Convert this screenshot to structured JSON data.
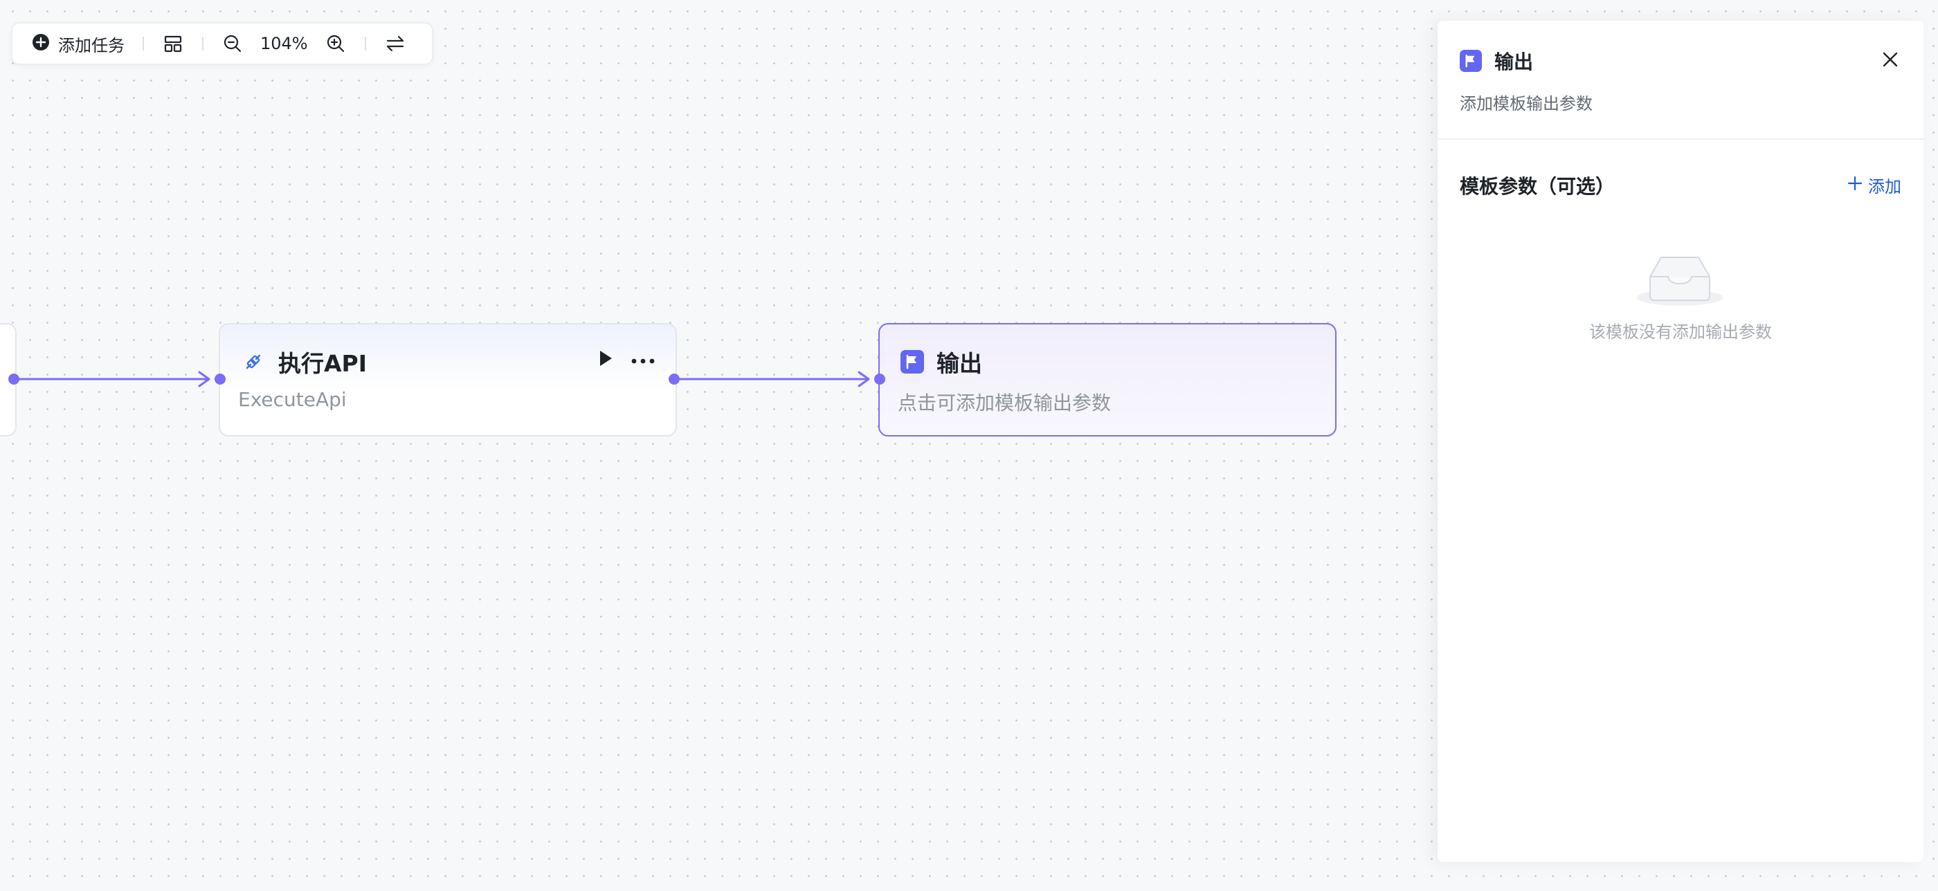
{
  "toolbar": {
    "add_task_label": "添加任务",
    "zoom_level": "104%",
    "icons": [
      "plus-circle-icon",
      "layout-grid-icon",
      "zoom-out-icon",
      "zoom-in-icon",
      "swap-direction-icon"
    ]
  },
  "flow": {
    "nodes": [
      {
        "title": "执行API",
        "subtitle": "ExecuteApi",
        "icon": "api-link-icon"
      },
      {
        "title": "输出",
        "subtitle": "点击可添加模板输出参数",
        "icon": "flag-icon"
      }
    ]
  },
  "panel": {
    "title": "输出",
    "description": "添加模板输出参数",
    "section_title": "模板参数（可选）",
    "add_label": "添加",
    "empty_text": "该模板没有添加输出参数"
  },
  "colors": {
    "accent": "#6366f1",
    "edge": "#7b6cf6",
    "link": "#1d5bd8"
  }
}
